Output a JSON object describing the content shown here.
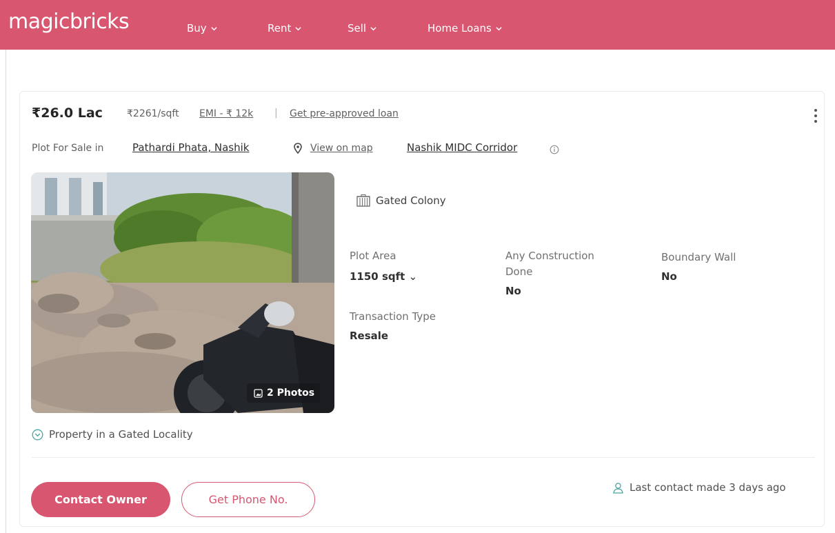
{
  "header": {
    "logo": "magicbricks",
    "nav": [
      {
        "label": "Buy"
      },
      {
        "label": "Rent"
      },
      {
        "label": "Sell"
      },
      {
        "label": "Home Loans"
      }
    ]
  },
  "listing": {
    "price": "₹26.0 Lac",
    "price_per_sqft": "₹2261/sqft",
    "emi": "EMI - ₹ 12k",
    "separator": "|",
    "loan_link": "Get pre-approved loan",
    "for_sale_prefix": "Plot For Sale in",
    "locality": "Pathardi Phata, Nashik",
    "map_link": "View on map",
    "corridor": "Nashik MIDC Corridor",
    "photo_count": "2 Photos",
    "tag": "Gated Colony",
    "specs": {
      "plot_area": {
        "label": "Plot Area",
        "value": "1150 sqft"
      },
      "construction": {
        "label_line1": "Any Construction",
        "label_line2": "Done",
        "value": "No"
      },
      "boundary_wall": {
        "label": "Boundary Wall",
        "value": "No"
      },
      "transaction": {
        "label": "Transaction Type",
        "value": "Resale"
      }
    },
    "highlight": "Property in a Gated Locality",
    "last_contact": "Last contact made 3 days ago"
  },
  "actions": {
    "contact_owner": "Contact Owner",
    "get_phone": "Get Phone No."
  },
  "colors": {
    "brand": "#d8566f",
    "teal_icon": "#4aa6a2"
  }
}
